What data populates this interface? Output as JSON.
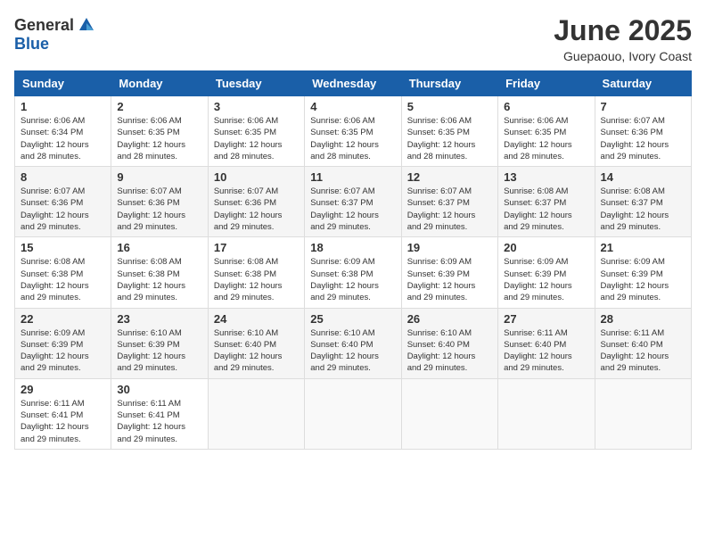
{
  "logo": {
    "general": "General",
    "blue": "Blue"
  },
  "title": "June 2025",
  "subtitle": "Guepaouo, Ivory Coast",
  "weekdays": [
    "Sunday",
    "Monday",
    "Tuesday",
    "Wednesday",
    "Thursday",
    "Friday",
    "Saturday"
  ],
  "weeks": [
    [
      {
        "day": "1",
        "info": "Sunrise: 6:06 AM\nSunset: 6:34 PM\nDaylight: 12 hours\nand 28 minutes."
      },
      {
        "day": "2",
        "info": "Sunrise: 6:06 AM\nSunset: 6:35 PM\nDaylight: 12 hours\nand 28 minutes."
      },
      {
        "day": "3",
        "info": "Sunrise: 6:06 AM\nSunset: 6:35 PM\nDaylight: 12 hours\nand 28 minutes."
      },
      {
        "day": "4",
        "info": "Sunrise: 6:06 AM\nSunset: 6:35 PM\nDaylight: 12 hours\nand 28 minutes."
      },
      {
        "day": "5",
        "info": "Sunrise: 6:06 AM\nSunset: 6:35 PM\nDaylight: 12 hours\nand 28 minutes."
      },
      {
        "day": "6",
        "info": "Sunrise: 6:06 AM\nSunset: 6:35 PM\nDaylight: 12 hours\nand 28 minutes."
      },
      {
        "day": "7",
        "info": "Sunrise: 6:07 AM\nSunset: 6:36 PM\nDaylight: 12 hours\nand 29 minutes."
      }
    ],
    [
      {
        "day": "8",
        "info": "Sunrise: 6:07 AM\nSunset: 6:36 PM\nDaylight: 12 hours\nand 29 minutes."
      },
      {
        "day": "9",
        "info": "Sunrise: 6:07 AM\nSunset: 6:36 PM\nDaylight: 12 hours\nand 29 minutes."
      },
      {
        "day": "10",
        "info": "Sunrise: 6:07 AM\nSunset: 6:36 PM\nDaylight: 12 hours\nand 29 minutes."
      },
      {
        "day": "11",
        "info": "Sunrise: 6:07 AM\nSunset: 6:37 PM\nDaylight: 12 hours\nand 29 minutes."
      },
      {
        "day": "12",
        "info": "Sunrise: 6:07 AM\nSunset: 6:37 PM\nDaylight: 12 hours\nand 29 minutes."
      },
      {
        "day": "13",
        "info": "Sunrise: 6:08 AM\nSunset: 6:37 PM\nDaylight: 12 hours\nand 29 minutes."
      },
      {
        "day": "14",
        "info": "Sunrise: 6:08 AM\nSunset: 6:37 PM\nDaylight: 12 hours\nand 29 minutes."
      }
    ],
    [
      {
        "day": "15",
        "info": "Sunrise: 6:08 AM\nSunset: 6:38 PM\nDaylight: 12 hours\nand 29 minutes."
      },
      {
        "day": "16",
        "info": "Sunrise: 6:08 AM\nSunset: 6:38 PM\nDaylight: 12 hours\nand 29 minutes."
      },
      {
        "day": "17",
        "info": "Sunrise: 6:08 AM\nSunset: 6:38 PM\nDaylight: 12 hours\nand 29 minutes."
      },
      {
        "day": "18",
        "info": "Sunrise: 6:09 AM\nSunset: 6:38 PM\nDaylight: 12 hours\nand 29 minutes."
      },
      {
        "day": "19",
        "info": "Sunrise: 6:09 AM\nSunset: 6:39 PM\nDaylight: 12 hours\nand 29 minutes."
      },
      {
        "day": "20",
        "info": "Sunrise: 6:09 AM\nSunset: 6:39 PM\nDaylight: 12 hours\nand 29 minutes."
      },
      {
        "day": "21",
        "info": "Sunrise: 6:09 AM\nSunset: 6:39 PM\nDaylight: 12 hours\nand 29 minutes."
      }
    ],
    [
      {
        "day": "22",
        "info": "Sunrise: 6:09 AM\nSunset: 6:39 PM\nDaylight: 12 hours\nand 29 minutes."
      },
      {
        "day": "23",
        "info": "Sunrise: 6:10 AM\nSunset: 6:39 PM\nDaylight: 12 hours\nand 29 minutes."
      },
      {
        "day": "24",
        "info": "Sunrise: 6:10 AM\nSunset: 6:40 PM\nDaylight: 12 hours\nand 29 minutes."
      },
      {
        "day": "25",
        "info": "Sunrise: 6:10 AM\nSunset: 6:40 PM\nDaylight: 12 hours\nand 29 minutes."
      },
      {
        "day": "26",
        "info": "Sunrise: 6:10 AM\nSunset: 6:40 PM\nDaylight: 12 hours\nand 29 minutes."
      },
      {
        "day": "27",
        "info": "Sunrise: 6:11 AM\nSunset: 6:40 PM\nDaylight: 12 hours\nand 29 minutes."
      },
      {
        "day": "28",
        "info": "Sunrise: 6:11 AM\nSunset: 6:40 PM\nDaylight: 12 hours\nand 29 minutes."
      }
    ],
    [
      {
        "day": "29",
        "info": "Sunrise: 6:11 AM\nSunset: 6:41 PM\nDaylight: 12 hours\nand 29 minutes."
      },
      {
        "day": "30",
        "info": "Sunrise: 6:11 AM\nSunset: 6:41 PM\nDaylight: 12 hours\nand 29 minutes."
      },
      {
        "day": "",
        "info": ""
      },
      {
        "day": "",
        "info": ""
      },
      {
        "day": "",
        "info": ""
      },
      {
        "day": "",
        "info": ""
      },
      {
        "day": "",
        "info": ""
      }
    ]
  ]
}
